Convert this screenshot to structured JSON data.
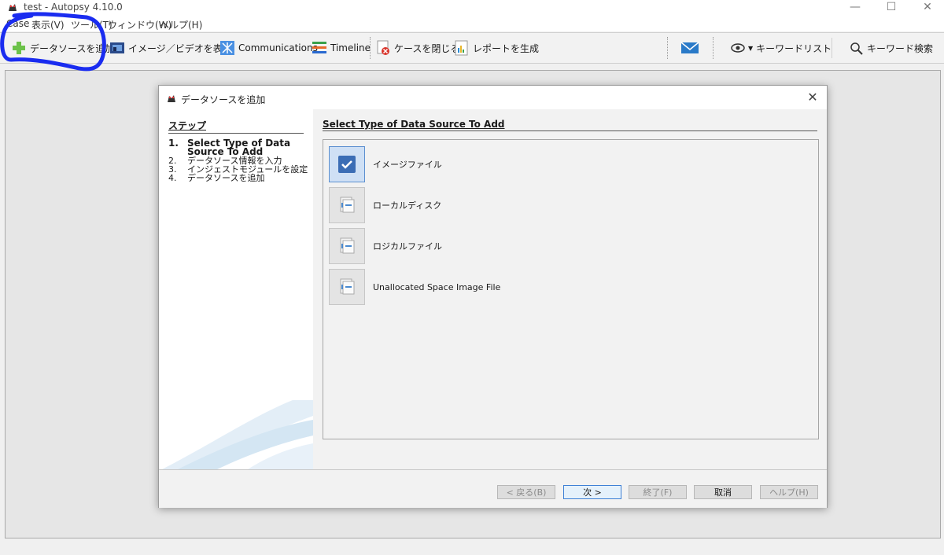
{
  "window": {
    "title": "test - Autopsy 4.10.0",
    "controls": {
      "minimize": "—",
      "maximize": "☐",
      "close": "✕"
    }
  },
  "menu": [
    {
      "label": "Case"
    },
    {
      "label": "表示(V)"
    },
    {
      "label": "ツール(T)"
    },
    {
      "label": "ウィンドウ(W)"
    },
    {
      "label": "ヘルプ(H)"
    }
  ],
  "toolbar": {
    "add_data_source": "データソースを追加",
    "view_images_videos": "イメージ／ビデオを表示",
    "communications": "Communications",
    "timeline": "Timeline",
    "close_case": "ケースを閉じる",
    "generate_report": "レポートを生成",
    "keyword_list": "キーワードリスト",
    "keyword_search": "キーワード検索"
  },
  "highlight_color": "#1a2cf0",
  "dialog": {
    "title": "データソースを追加",
    "close_label": "✕",
    "steps_heading": "ステップ",
    "steps": [
      {
        "num": "1.",
        "label": "Select Type of Data Source To Add",
        "active": true
      },
      {
        "num": "2.",
        "label": "データソース情報を入力",
        "active": false
      },
      {
        "num": "3.",
        "label": "インジェストモジュールを設定",
        "active": false
      },
      {
        "num": "4.",
        "label": "データソースを追加",
        "active": false
      }
    ],
    "content_heading": "Select Type of Data Source To Add",
    "options": [
      {
        "label": "イメージファイル",
        "selected": true,
        "icon": "disk-image-icon"
      },
      {
        "label": "ローカルディスク",
        "selected": false,
        "icon": "local-disk-icon"
      },
      {
        "label": "ロジカルファイル",
        "selected": false,
        "icon": "logical-files-icon"
      },
      {
        "label": "Unallocated Space Image File",
        "selected": false,
        "icon": "unallocated-space-icon"
      }
    ],
    "buttons": {
      "back": "< 戻る(B)",
      "next": "次 >",
      "finish": "終了(F)",
      "cancel": "取消",
      "help": "ヘルプ(H)"
    }
  }
}
